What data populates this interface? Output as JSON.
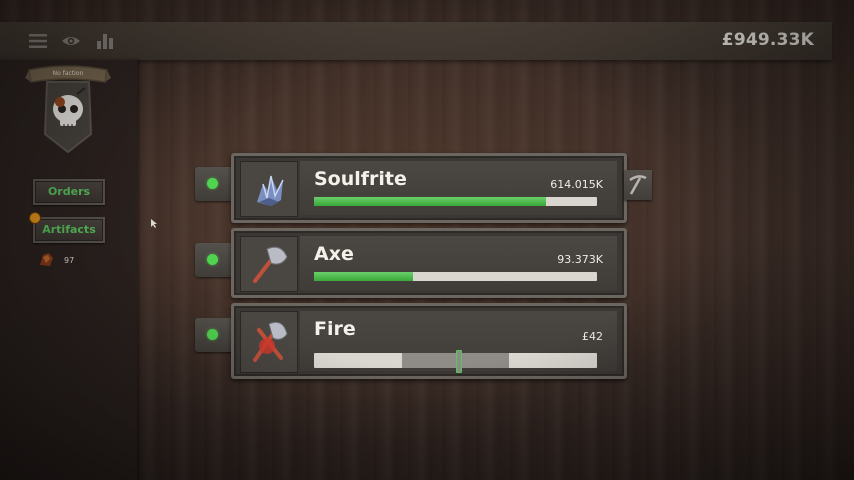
{
  "header": {
    "money": "£949.33K",
    "icons": [
      "menu-icon",
      "eye-icon",
      "stats-icon"
    ]
  },
  "sidebar": {
    "faction_label": "No faction",
    "orders_label": "Orders",
    "artifacts_label": "Artifacts",
    "artifact_count": "97"
  },
  "resources": [
    {
      "name": "Soulfrite",
      "value": "614.015K",
      "progress": 0.82,
      "icon": "soulfrite-crystal-icon"
    },
    {
      "name": "Axe",
      "value": "93.373K",
      "progress": 0.35,
      "icon": "axe-icon"
    },
    {
      "name": "Fire",
      "value": "£42",
      "slider": {
        "zone_start": 0.31,
        "zone_end": 0.69,
        "handle": 0.51
      },
      "icon": "fire-axe-icon"
    }
  ],
  "colors": {
    "accent_green": "#4fd44f",
    "button_text_green": "#5cc65e",
    "alert_orange": "#e8961e"
  }
}
